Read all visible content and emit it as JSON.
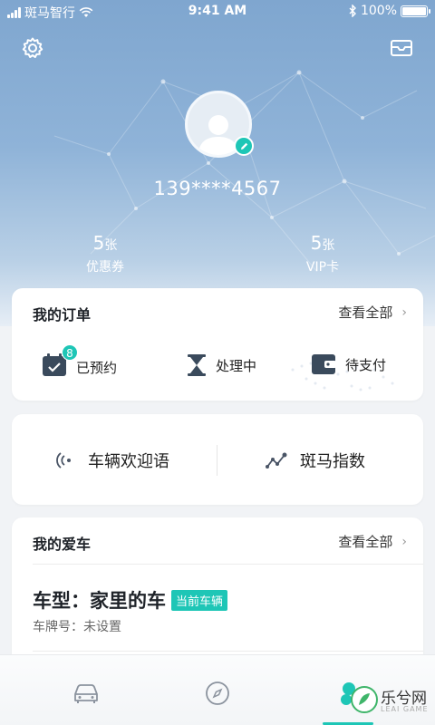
{
  "status_bar": {
    "carrier": "斑马智行",
    "time": "9:41 AM",
    "battery": "100%"
  },
  "header": {
    "settings_icon": "gear-icon",
    "message_icon": "mail-icon"
  },
  "profile": {
    "phone": "139****4567",
    "stats": [
      {
        "num": "5",
        "unit": "张",
        "label": "优惠券"
      },
      {
        "num": "5",
        "unit": "张",
        "label": "VIP卡"
      }
    ]
  },
  "orders": {
    "title": "我的订单",
    "view_all": "查看全部",
    "items": [
      {
        "label": "已预约",
        "icon": "calendar-check-icon",
        "badge": "8"
      },
      {
        "label": "处理中",
        "icon": "hourglass-icon"
      },
      {
        "label": "待支付",
        "icon": "wallet-icon"
      }
    ]
  },
  "quick": {
    "items": [
      {
        "label": "车辆欢迎语",
        "icon": "sound-wave-icon"
      },
      {
        "label": "斑马指数",
        "icon": "trend-line-icon"
      }
    ]
  },
  "car": {
    "title": "我的爱车",
    "view_all": "查看全部",
    "model": "车型：家里的车",
    "current_tag": "当前车辆",
    "plate": "车牌号：未设置"
  },
  "tabbar": {
    "tabs": [
      {
        "icon": "car-icon"
      },
      {
        "icon": "compass-icon"
      },
      {
        "icon": "profile-icon",
        "active": true
      }
    ]
  },
  "watermark": {
    "text": "乐兮网",
    "sub": "LEAI GAME"
  },
  "colors": {
    "accent": "#1ec6b6",
    "hero_top": "#7fa6cf"
  }
}
